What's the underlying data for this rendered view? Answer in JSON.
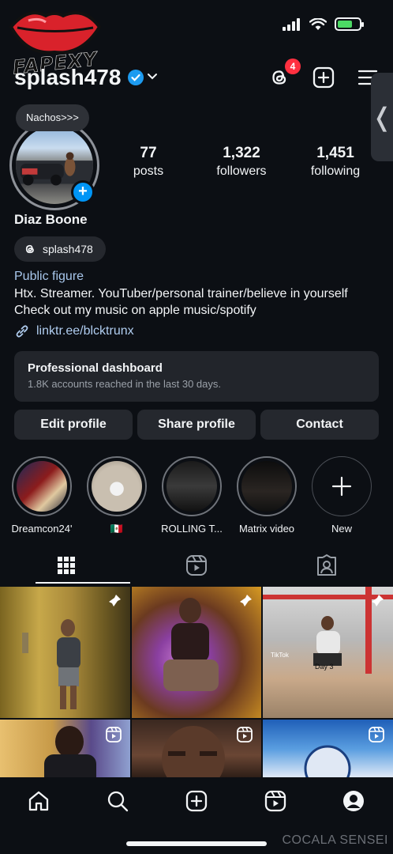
{
  "watermark_logo": {
    "text": "FAPEXY"
  },
  "header": {
    "username": "splash478",
    "threads_badge": "4",
    "side_tab_glyph": "❬"
  },
  "note": "Nachos>>>",
  "stats": [
    {
      "value": "77",
      "label": "posts"
    },
    {
      "value": "1,322",
      "label": "followers"
    },
    {
      "value": "1,451",
      "label": "following"
    }
  ],
  "profile": {
    "name": "Diaz Boone",
    "threads_handle": "splash478",
    "category": "Public figure",
    "bio_line1": "Htx. Streamer. YouTuber/personal trainer/believe in yourself",
    "bio_line2": "Check out my music on apple music/spotify",
    "link": "linktr.ee/blcktrunx"
  },
  "dashboard": {
    "title": "Professional dashboard",
    "subtitle": "1.8K accounts reached in the last 30 days."
  },
  "buttons": {
    "edit": "Edit profile",
    "share": "Share profile",
    "contact": "Contact"
  },
  "highlights": [
    {
      "label": "Dreamcon24'"
    },
    {
      "label": "🇲🇽"
    },
    {
      "label": "ROLLING T..."
    },
    {
      "label": "Matrix video"
    },
    {
      "label": "New"
    }
  ],
  "grid_captions": {
    "tiktok": "TikTok",
    "day3": "Day 3"
  },
  "footer_watermark": "COCALA SENSEI",
  "colors": {
    "background": "#0c0f14",
    "accent_blue": "#0095f6",
    "badge_red": "#ff3040",
    "card": "#25282e"
  }
}
